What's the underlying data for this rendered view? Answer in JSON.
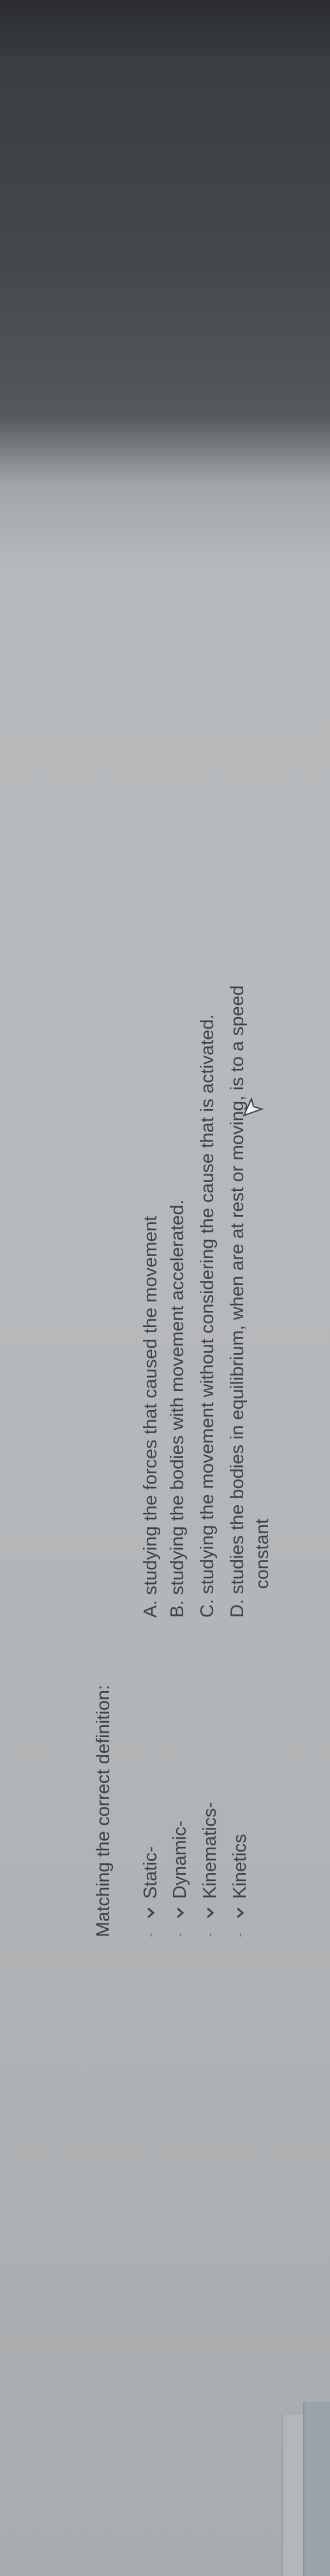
{
  "question": {
    "title": "Matching the correct definition:"
  },
  "terms": [
    {
      "label": "Static-"
    },
    {
      "label": "Dynamic-"
    },
    {
      "label": "Kinematics-"
    },
    {
      "label": "Kinetics"
    }
  ],
  "definitions": [
    {
      "text": "A. studying the forces that caused the movement"
    },
    {
      "text": "B. studying the bodies with movement accelerated."
    },
    {
      "text": "C. studying the movement without considering the cause that is activated."
    },
    {
      "text": "D. studies the bodies in equilibrium, when are at rest or moving, is to a speed"
    },
    {
      "text": "constant"
    }
  ],
  "icons": {
    "dropdown": "chevron-down-icon",
    "pointer": "mouse-cursor-icon"
  }
}
